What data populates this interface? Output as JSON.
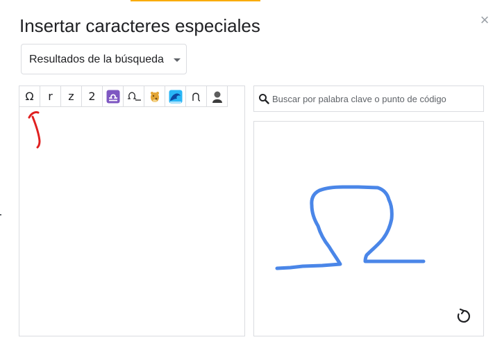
{
  "dialog": {
    "title": "Insertar caracteres especiales",
    "close_label": "×"
  },
  "category_dropdown": {
    "selected": "Resultados de la búsqueda"
  },
  "results": {
    "cells": [
      {
        "type": "text",
        "value": "Ω",
        "name": "omega"
      },
      {
        "type": "text",
        "value": "r",
        "name": "latin-r"
      },
      {
        "type": "text",
        "value": "z",
        "name": "latin-z"
      },
      {
        "type": "text",
        "value": "2",
        "name": "digit-two"
      },
      {
        "type": "icon",
        "icon": "libra-emoji-icon",
        "name": "libra"
      },
      {
        "type": "icon",
        "icon": "omega-stroke-icon",
        "name": "omega-stroke"
      },
      {
        "type": "icon",
        "icon": "giraffe-emoji-icon",
        "name": "giraffe"
      },
      {
        "type": "icon",
        "icon": "wave-emoji-icon",
        "name": "water-wave"
      },
      {
        "type": "icon",
        "icon": "small-omega-icon",
        "name": "small-omega"
      },
      {
        "type": "icon",
        "icon": "bust-silhouette-icon",
        "name": "bust"
      }
    ]
  },
  "search": {
    "placeholder": "Buscar por palabra clave o punto de código",
    "value": ""
  },
  "colors": {
    "accent_bar": "#f9ab00",
    "stroke": "#4a86e8",
    "annotation": "#e02020",
    "border": "#dadce0"
  }
}
